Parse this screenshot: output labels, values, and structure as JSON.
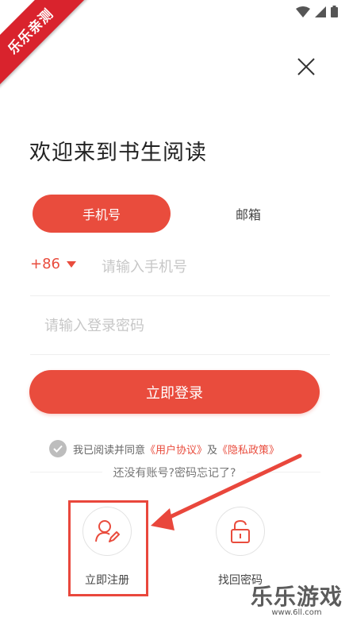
{
  "watermark": {
    "ribbon": "乐乐亲测",
    "bottom_title": "乐乐游戏",
    "bottom_url": "www.6ll.com"
  },
  "header": {
    "welcome": "欢迎来到书生阅读"
  },
  "tabs": [
    {
      "label": "手机号",
      "active": true
    },
    {
      "label": "邮箱",
      "active": false
    }
  ],
  "phone": {
    "country_code": "+86",
    "placeholder": "请输入手机号"
  },
  "password": {
    "placeholder": "请输入登录密码"
  },
  "login_button": "立即登录",
  "agreement": {
    "prefix": "我已阅读并同意",
    "user_agreement": "《用户协议》",
    "and": "及",
    "privacy_policy": "《隐私政策》"
  },
  "forgot_line": "还没有账号?密码忘记了?",
  "options": {
    "register": "立即注册",
    "recover": "找回密码"
  },
  "colors": {
    "accent": "#e94c3d",
    "highlight": "#e9473c"
  }
}
